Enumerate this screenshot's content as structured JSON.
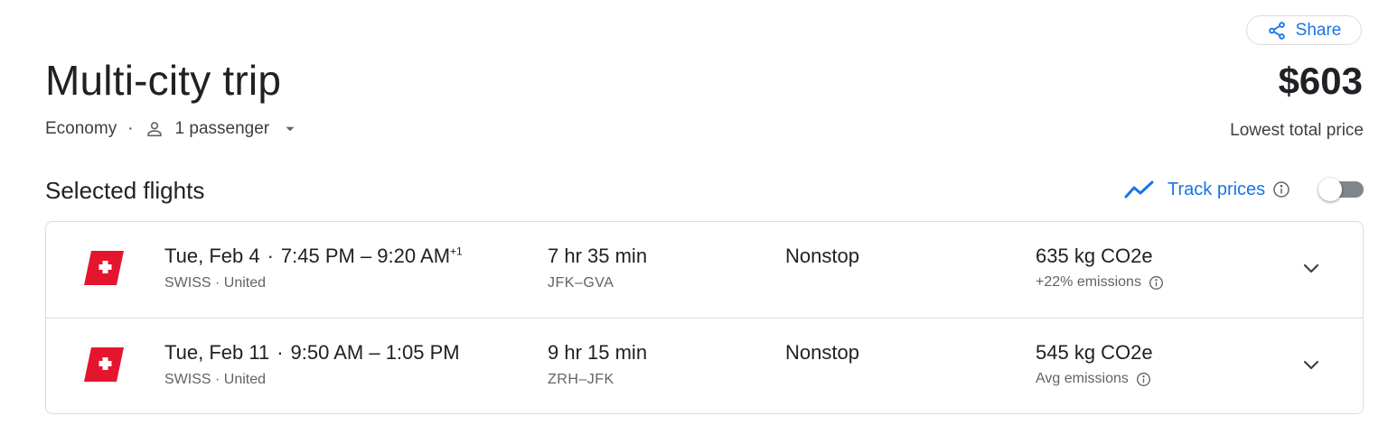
{
  "header": {
    "share_label": "Share",
    "title": "Multi-city trip",
    "price": "$603",
    "price_label": "Lowest total price",
    "cabin": "Economy",
    "separator": "·",
    "passengers": "1 passenger"
  },
  "section": {
    "title": "Selected flights",
    "track_label": "Track prices",
    "track_enabled": false
  },
  "colors": {
    "accent": "#1a73e8",
    "swiss_red": "#e4162d"
  },
  "flights": [
    {
      "date": "Tue, Feb 4",
      "sep": "·",
      "times": "7:45 PM – 9:20 AM",
      "day_offset": "+1",
      "carriers": "SWISS · United",
      "duration": "7 hr 35 min",
      "route": "JFK–GVA",
      "stops": "Nonstop",
      "co2": "635 kg CO2e",
      "emissions": "+22% emissions"
    },
    {
      "date": "Tue, Feb 11",
      "sep": "·",
      "times": "9:50 AM – 1:05 PM",
      "carriers": "SWISS · United",
      "duration": "9 hr 15 min",
      "route": "ZRH–JFK",
      "stops": "Nonstop",
      "co2": "545 kg CO2e",
      "emissions": "Avg emissions"
    }
  ]
}
